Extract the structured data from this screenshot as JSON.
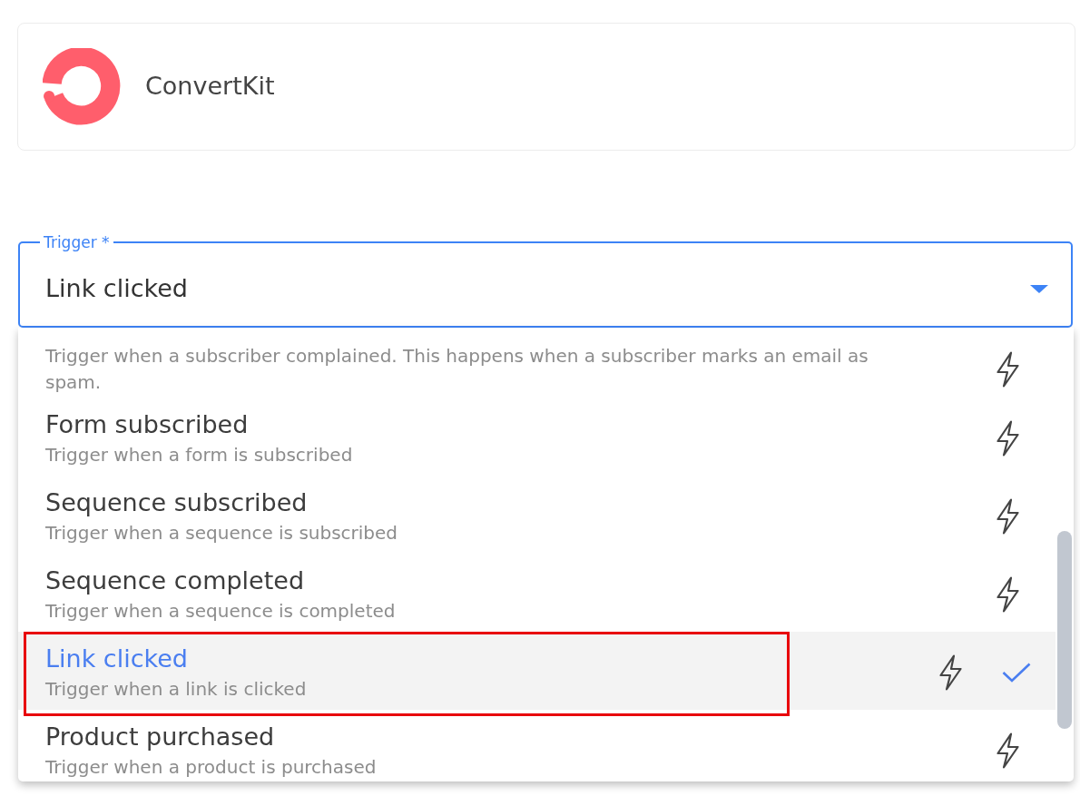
{
  "integration": {
    "name": "ConvertKit"
  },
  "trigger_field": {
    "label": "Trigger *",
    "value": "Link clicked",
    "expanded": true
  },
  "options": [
    {
      "description": "Trigger when a subscriber complained. This happens when a subscriber marks an email as spam.",
      "selected": false,
      "highlighted": false
    },
    {
      "title": "Form subscribed",
      "description": "Trigger when a form is subscribed",
      "selected": false,
      "highlighted": false
    },
    {
      "title": "Sequence subscribed",
      "description": "Trigger when a sequence is subscribed",
      "selected": false,
      "highlighted": false
    },
    {
      "title": "Sequence completed",
      "description": "Trigger when a sequence is completed",
      "selected": false,
      "highlighted": false
    },
    {
      "title": "Link clicked",
      "description": "Trigger when a link is clicked",
      "selected": true,
      "highlighted": true
    },
    {
      "title": "Product purchased",
      "description": "Trigger when a product is purchased",
      "selected": false,
      "highlighted": false
    }
  ]
}
